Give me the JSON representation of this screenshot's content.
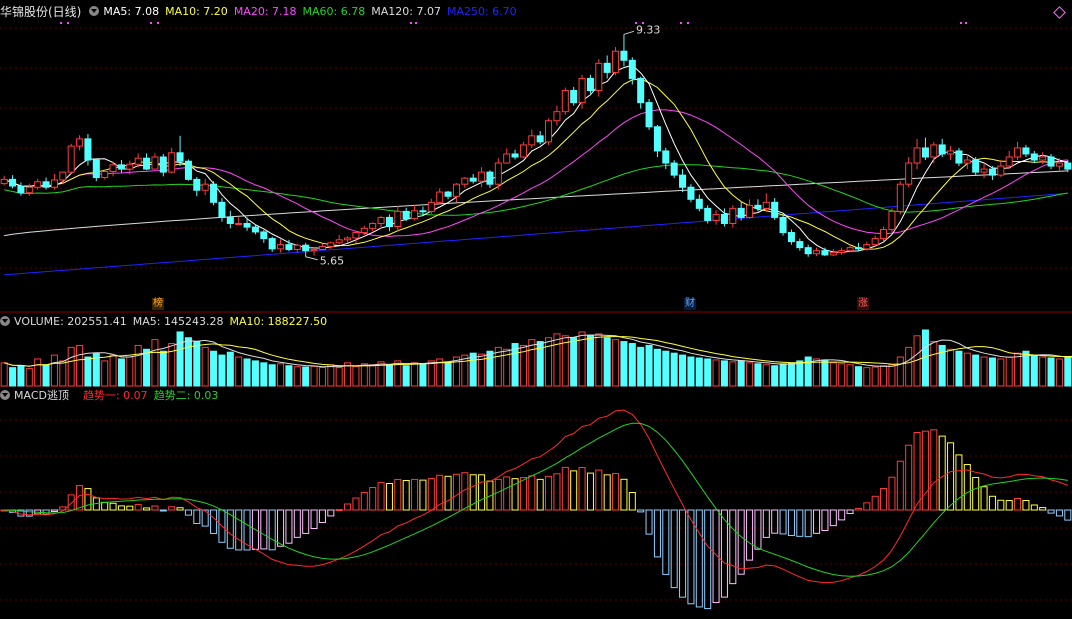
{
  "stock_label": "华锦股份(日线)",
  "ma_legend": [
    {
      "label": "MA5: 7.08",
      "color": "#ffffff"
    },
    {
      "label": "MA10: 7.20",
      "color": "#ffff3a"
    },
    {
      "label": "MA20: 7.18",
      "color": "#ff46ff"
    },
    {
      "label": "MA60: 6.78",
      "color": "#22d422"
    },
    {
      "label": "MA120: 7.07",
      "color": "#dcdcdc"
    },
    {
      "label": "MA250: 6.70",
      "color": "#2222ff"
    }
  ],
  "volume_legend": [
    {
      "label": "VOLUME: 202551.41",
      "color": "#dcdcdc"
    },
    {
      "label": "MA5: 145243.28",
      "color": "#dcdcdc"
    },
    {
      "label": "MA10: 188227.50",
      "color": "#ffff3a"
    }
  ],
  "macd_legend": [
    {
      "label": "MACD逃顶",
      "color": "#dcdcdc"
    },
    {
      "label": "趋势一: 0.07",
      "color": "#ff2a2a"
    },
    {
      "label": "趋势二: 0.03",
      "color": "#22d422"
    }
  ],
  "markers": [
    {
      "text": "榜",
      "color": "#ffaa00",
      "bg": "#3a2400"
    },
    {
      "text": "财",
      "color": "#5fa8ff",
      "bg": "#0a1a3a"
    },
    {
      "text": "涨",
      "color": "#ff6060",
      "bg": "#3a0a0a"
    }
  ],
  "annotations": {
    "high": "9.33",
    "low": "5.65"
  },
  "chart_data": [
    {
      "type": "candlestick",
      "title": "华锦股份(日线)",
      "price_range": [
        5.0,
        9.6
      ],
      "num_bars": 133,
      "candles": [
        [
          6.86,
          6.93,
          6.99,
          6.83
        ],
        [
          6.93,
          6.82,
          7.0,
          6.78
        ],
        [
          6.82,
          6.71,
          6.88,
          6.66
        ],
        [
          6.71,
          6.8,
          6.86,
          6.66
        ],
        [
          6.8,
          6.89,
          6.94,
          6.76
        ],
        [
          6.89,
          6.8,
          6.96,
          6.76
        ],
        [
          6.8,
          6.92,
          7.02,
          6.76
        ],
        [
          6.92,
          7.05,
          7.06,
          6.85
        ],
        [
          7.05,
          7.48,
          7.52,
          7.02
        ],
        [
          7.48,
          7.6,
          7.66,
          7.41
        ],
        [
          7.6,
          7.25,
          7.68,
          7.16
        ],
        [
          7.25,
          6.96,
          7.27,
          6.9
        ],
        [
          6.96,
          7.06,
          7.08,
          6.93
        ],
        [
          7.06,
          7.17,
          7.22,
          6.98
        ],
        [
          7.17,
          7.1,
          7.25,
          7.04
        ],
        [
          7.1,
          7.18,
          7.24,
          7.01
        ],
        [
          7.18,
          7.28,
          7.36,
          7.13
        ],
        [
          7.28,
          7.1,
          7.36,
          7.08
        ],
        [
          7.1,
          7.3,
          7.36,
          7.09
        ],
        [
          7.3,
          7.05,
          7.35,
          6.98
        ],
        [
          7.05,
          7.37,
          7.45,
          7.03
        ],
        [
          7.37,
          7.23,
          7.65,
          7.15
        ],
        [
          7.23,
          6.93,
          7.26,
          6.91
        ],
        [
          6.93,
          6.75,
          6.97,
          6.65
        ],
        [
          6.75,
          6.85,
          6.94,
          6.67
        ],
        [
          6.85,
          6.55,
          6.9,
          6.5
        ],
        [
          6.55,
          6.3,
          6.62,
          6.23
        ],
        [
          6.3,
          6.2,
          6.41,
          6.12
        ],
        [
          6.2,
          6.2,
          6.31,
          6.17
        ],
        [
          6.2,
          6.14,
          6.3,
          6.08
        ],
        [
          6.14,
          6.06,
          6.18,
          6.02
        ],
        [
          6.06,
          5.95,
          6.09,
          5.88
        ],
        [
          5.95,
          5.78,
          5.98,
          5.73
        ],
        [
          5.78,
          5.85,
          5.94,
          5.72
        ],
        [
          5.85,
          5.77,
          5.93,
          5.74
        ],
        [
          5.77,
          5.84,
          5.86,
          5.72
        ],
        [
          5.84,
          5.75,
          5.88,
          5.65
        ],
        [
          5.75,
          5.77,
          5.81,
          5.67
        ],
        [
          5.77,
          5.82,
          5.87,
          5.76
        ],
        [
          5.82,
          5.88,
          5.9,
          5.78
        ],
        [
          5.88,
          5.93,
          6.01,
          5.85
        ],
        [
          5.93,
          5.96,
          5.99,
          5.88
        ],
        [
          5.96,
          6.05,
          6.08,
          5.87
        ],
        [
          6.05,
          6.12,
          6.16,
          6.01
        ],
        [
          6.12,
          6.2,
          6.22,
          6.07
        ],
        [
          6.2,
          6.3,
          6.33,
          6.11
        ],
        [
          6.3,
          6.15,
          6.35,
          6.07
        ],
        [
          6.15,
          6.4,
          6.49,
          6.06
        ],
        [
          6.4,
          6.28,
          6.46,
          6.24
        ],
        [
          6.28,
          6.41,
          6.51,
          6.25
        ],
        [
          6.41,
          6.4,
          6.48,
          6.33
        ],
        [
          6.4,
          6.55,
          6.61,
          6.36
        ],
        [
          6.55,
          6.72,
          6.78,
          6.52
        ],
        [
          6.72,
          6.65,
          6.74,
          6.6
        ],
        [
          6.65,
          6.85,
          6.87,
          6.55
        ],
        [
          6.85,
          6.95,
          6.97,
          6.79
        ],
        [
          6.95,
          6.9,
          7.02,
          6.86
        ],
        [
          6.9,
          7.05,
          7.13,
          6.8
        ],
        [
          7.05,
          6.85,
          7.08,
          6.79
        ],
        [
          6.85,
          7.2,
          7.28,
          6.76
        ],
        [
          7.2,
          7.35,
          7.44,
          7.19
        ],
        [
          7.35,
          7.3,
          7.42,
          7.26
        ],
        [
          7.3,
          7.5,
          7.55,
          7.28
        ],
        [
          7.5,
          7.65,
          7.75,
          7.45
        ],
        [
          7.65,
          7.55,
          7.73,
          7.51
        ],
        [
          7.55,
          7.9,
          7.94,
          7.5
        ],
        [
          7.9,
          8.05,
          8.15,
          7.82
        ],
        [
          8.05,
          8.4,
          8.45,
          8.0
        ],
        [
          8.4,
          8.2,
          8.46,
          8.15
        ],
        [
          8.2,
          8.6,
          8.66,
          8.1
        ],
        [
          8.6,
          8.4,
          8.66,
          8.35
        ],
        [
          8.4,
          8.85,
          8.92,
          8.3
        ],
        [
          8.85,
          8.7,
          8.98,
          8.6
        ],
        [
          8.7,
          9.05,
          9.12,
          8.65
        ],
        [
          9.05,
          8.9,
          9.33,
          8.8
        ],
        [
          8.9,
          8.6,
          8.95,
          8.5
        ],
        [
          8.6,
          8.2,
          8.63,
          8.1
        ],
        [
          8.2,
          7.8,
          8.26,
          7.75
        ],
        [
          7.8,
          7.4,
          7.83,
          7.3
        ],
        [
          7.4,
          7.2,
          7.45,
          7.1
        ],
        [
          7.2,
          7.0,
          7.25,
          6.95
        ],
        [
          7.0,
          6.8,
          7.1,
          6.72
        ],
        [
          6.8,
          6.6,
          6.85,
          6.55
        ],
        [
          6.6,
          6.45,
          6.68,
          6.4
        ],
        [
          6.45,
          6.25,
          6.5,
          6.2
        ],
        [
          6.25,
          6.35,
          6.42,
          6.18
        ],
        [
          6.35,
          6.2,
          6.45,
          6.15
        ],
        [
          6.2,
          6.45,
          6.5,
          6.13
        ],
        [
          6.45,
          6.3,
          6.55,
          6.25
        ],
        [
          6.3,
          6.5,
          6.6,
          6.28
        ],
        [
          6.5,
          6.45,
          6.6,
          6.4
        ],
        [
          6.45,
          6.55,
          6.7,
          6.39
        ],
        [
          6.55,
          6.3,
          6.62,
          6.26
        ],
        [
          6.3,
          6.05,
          6.35,
          6.0
        ],
        [
          6.05,
          5.9,
          6.1,
          5.85
        ],
        [
          5.9,
          5.8,
          5.95,
          5.75
        ],
        [
          5.8,
          5.7,
          5.85,
          5.65
        ],
        [
          5.7,
          5.75,
          5.8,
          5.66
        ],
        [
          5.75,
          5.68,
          5.8,
          5.66
        ],
        [
          5.68,
          5.72,
          5.78,
          5.66
        ],
        [
          5.72,
          5.75,
          5.8,
          5.68
        ],
        [
          5.75,
          5.8,
          5.85,
          5.72
        ],
        [
          5.8,
          5.78,
          5.88,
          5.74
        ],
        [
          5.78,
          5.85,
          5.9,
          5.75
        ],
        [
          5.85,
          5.95,
          6.0,
          5.82
        ],
        [
          5.95,
          6.1,
          6.15,
          5.9
        ],
        [
          6.1,
          6.4,
          6.45,
          6.05
        ],
        [
          6.4,
          6.85,
          6.9,
          6.35
        ],
        [
          6.85,
          7.2,
          7.3,
          6.8
        ],
        [
          7.2,
          7.45,
          7.6,
          7.1
        ],
        [
          7.45,
          7.3,
          7.62,
          7.25
        ],
        [
          7.3,
          7.5,
          7.55,
          7.2
        ],
        [
          7.5,
          7.35,
          7.6,
          7.3
        ],
        [
          7.35,
          7.4,
          7.48,
          7.25
        ],
        [
          7.4,
          7.2,
          7.45,
          7.15
        ],
        [
          7.2,
          7.25,
          7.35,
          7.1
        ],
        [
          7.25,
          7.05,
          7.3,
          7.0
        ],
        [
          7.05,
          7.1,
          7.2,
          6.95
        ],
        [
          7.1,
          7.0,
          7.15,
          6.92
        ],
        [
          7.0,
          7.15,
          7.25,
          6.97
        ],
        [
          7.15,
          7.3,
          7.4,
          7.1
        ],
        [
          7.3,
          7.45,
          7.55,
          7.25
        ],
        [
          7.45,
          7.35,
          7.5,
          7.3
        ],
        [
          7.35,
          7.25,
          7.4,
          7.2
        ],
        [
          7.25,
          7.3,
          7.38,
          7.18
        ],
        [
          7.3,
          7.15,
          7.35,
          7.1
        ],
        [
          7.15,
          7.2,
          7.28,
          7.08
        ],
        [
          7.2,
          7.1,
          7.25,
          7.05
        ]
      ],
      "indicators": [
        {
          "name": "MA5",
          "value": 7.08,
          "color": "#ffffff"
        },
        {
          "name": "MA10",
          "value": 7.2,
          "color": "#ffff3a"
        },
        {
          "name": "MA20",
          "value": 7.18,
          "color": "#ff46ff"
        },
        {
          "name": "MA60",
          "value": 6.78,
          "color": "#22d422"
        },
        {
          "name": "MA120",
          "value": 7.07,
          "color": "#dcdcdc"
        },
        {
          "name": "MA250",
          "value": 6.7,
          "color": "#2222ff"
        }
      ],
      "annotations": [
        {
          "text": "9.33",
          "kind": "high"
        },
        {
          "text": "5.65",
          "kind": "low"
        }
      ]
    },
    {
      "type": "bar",
      "title": "VOLUME",
      "values": [
        120000,
        95000,
        105000,
        90000,
        140000,
        110000,
        160000,
        130000,
        200000,
        210000,
        150000,
        170000,
        130000,
        160000,
        140000,
        150000,
        210000,
        190000,
        240000,
        180000,
        220000,
        280000,
        250000,
        230000,
        200000,
        180000,
        160000,
        175000,
        150000,
        140000,
        130000,
        120000,
        110000,
        115000,
        105000,
        100000,
        98000,
        102000,
        96000,
        110000,
        95000,
        120000,
        100000,
        115000,
        110000,
        125000,
        110000,
        130000,
        105000,
        120000,
        115000,
        130000,
        140000,
        125000,
        150000,
        160000,
        170000,
        165000,
        180000,
        200000,
        190000,
        220000,
        210000,
        240000,
        230000,
        250000,
        270000,
        260000,
        250000,
        280000,
        260000,
        270000,
        250000,
        240000,
        230000,
        220000,
        200000,
        210000,
        190000,
        180000,
        170000,
        160000,
        150000,
        145000,
        140000,
        135000,
        130000,
        125000,
        130000,
        120000,
        115000,
        110000,
        105000,
        115000,
        120000,
        130000,
        150000,
        140000,
        135000,
        120000,
        115000,
        110000,
        100000,
        95000,
        98000,
        105000,
        110000,
        150000,
        200000,
        260000,
        290000,
        230000,
        210000,
        190000,
        180000,
        170000,
        160000,
        150000,
        145000,
        140000,
        150000,
        170000,
        180000,
        160000,
        150000,
        145000,
        140000,
        150000,
        160000,
        170000,
        150000,
        145000,
        202551
      ],
      "indicators": [
        {
          "name": "VOLUME",
          "value": 202551.41
        },
        {
          "name": "MA5",
          "value": 145243.28
        },
        {
          "name": "MA10",
          "value": 188227.5
        }
      ]
    },
    {
      "type": "bar",
      "title": "MACD逃顶",
      "series": [
        {
          "name": "趋势一",
          "value": 0.07,
          "color": "#ff2a2a"
        },
        {
          "name": "趋势二",
          "value": 0.03,
          "color": "#22d422"
        }
      ]
    }
  ]
}
